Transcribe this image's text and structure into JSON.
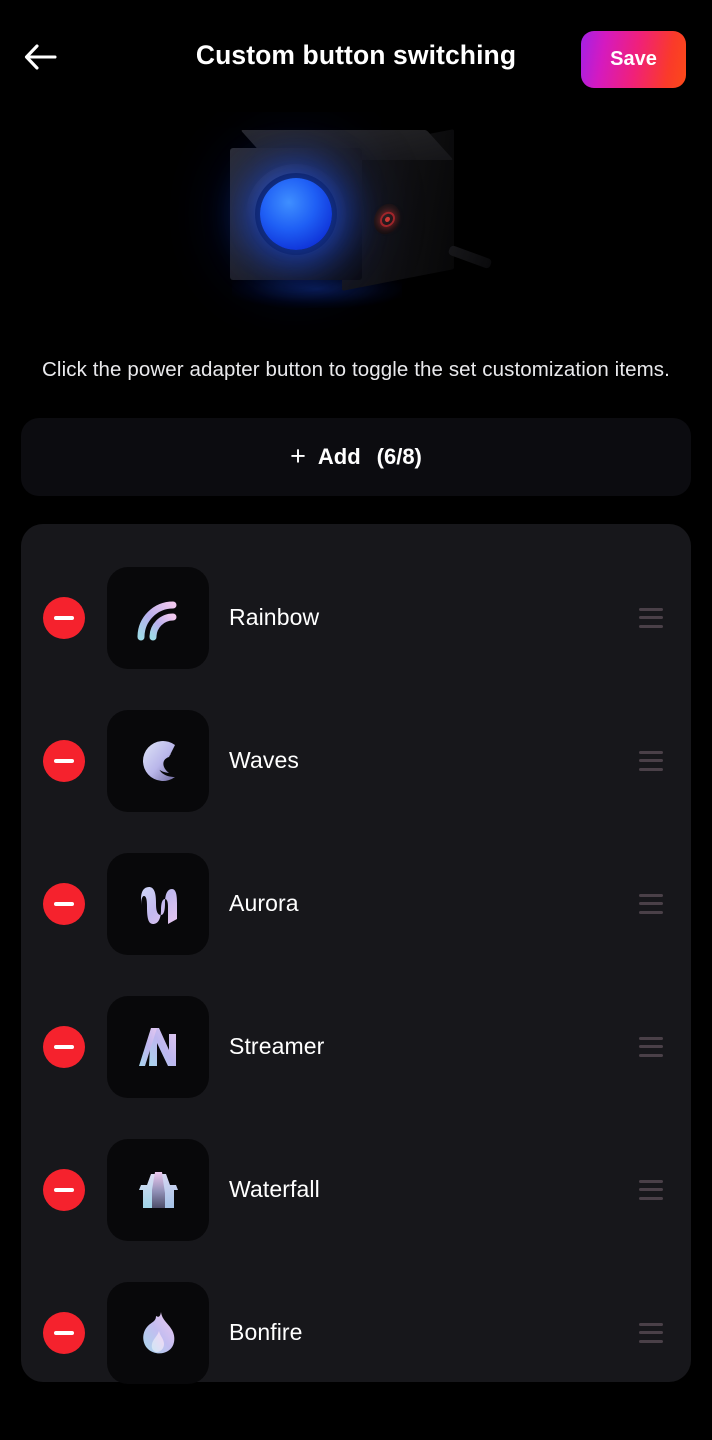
{
  "header": {
    "back_icon": "arrow-left-icon",
    "title": "Custom button switching",
    "save_label": "Save",
    "save_gradient_from": "#a321e6",
    "save_gradient_to": "#fc4a18"
  },
  "hero": {
    "device_name": "power-adapter-speaker-device",
    "button_glow_color": "#1f5ff5",
    "side_led_color": "#d03a35"
  },
  "instruction": {
    "text": "Click the power adapter button to toggle the set customization items."
  },
  "add_button": {
    "plus_icon": "plus-icon",
    "label": "Add",
    "count": "(6/8)",
    "current": 6,
    "max": 8
  },
  "list": {
    "remove_color": "#f5222d",
    "drag_handle_icon": "drag-handle-icon",
    "items": [
      {
        "label": "Rainbow",
        "icon": "rainbow-arcs-icon",
        "remove_icon": "minus-circle-icon"
      },
      {
        "label": "Waves",
        "icon": "wave-swirl-icon",
        "remove_icon": "minus-circle-icon"
      },
      {
        "label": "Aurora",
        "icon": "aurora-ribbon-icon",
        "remove_icon": "minus-circle-icon"
      },
      {
        "label": "Streamer",
        "icon": "streamer-bolt-icon",
        "remove_icon": "minus-circle-icon"
      },
      {
        "label": "Waterfall",
        "icon": "waterfall-icon",
        "remove_icon": "minus-circle-icon"
      },
      {
        "label": "Bonfire",
        "icon": "flame-icon",
        "remove_icon": "minus-circle-icon"
      }
    ]
  }
}
